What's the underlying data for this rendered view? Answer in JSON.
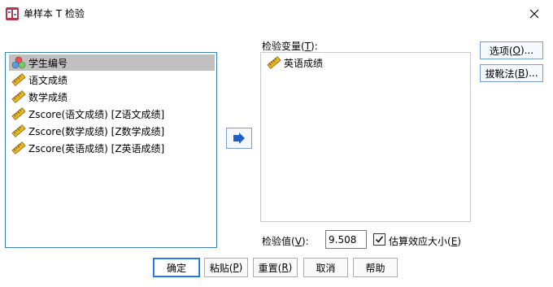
{
  "window": {
    "title": "单样本 T 检验",
    "close_icon": "close-icon"
  },
  "source_vars": [
    {
      "label": "学生编号",
      "icon": "nominal-variable-icon",
      "selected": true
    },
    {
      "label": "语文成绩",
      "icon": "scale-variable-icon",
      "selected": false
    },
    {
      "label": "数学成绩",
      "icon": "scale-variable-icon",
      "selected": false
    },
    {
      "label": "Zscore(语文成绩) [Z语文成绩]",
      "icon": "scale-variable-icon",
      "selected": false
    },
    {
      "label": "Zscore(数学成绩) [Z数学成绩]",
      "icon": "scale-variable-icon",
      "selected": false
    },
    {
      "label": "Zscore(英语成绩) [Z英语成绩]",
      "icon": "scale-variable-icon",
      "selected": false
    }
  ],
  "test_vars": {
    "label_pre": "检验变量(",
    "label_key": "T",
    "label_post": "):",
    "items": [
      {
        "label": "英语成绩",
        "icon": "scale-variable-icon"
      }
    ]
  },
  "side_buttons": {
    "options_pre": "选项(",
    "options_key": "O",
    "options_post": ")...",
    "bootstrap_pre": "拔靴法(",
    "bootstrap_key": "B",
    "bootstrap_post": ")..."
  },
  "test_value": {
    "label_pre": "检验值(",
    "label_key": "V",
    "label_post": "):",
    "value": "9.508"
  },
  "effect_size": {
    "checked": true,
    "label_pre": "估算效应大小(",
    "label_key": "E",
    "label_post": ")"
  },
  "bottom_buttons": {
    "ok": "确定",
    "paste_pre": "粘贴(",
    "paste_key": "P",
    "paste_post": ")",
    "reset_pre": "重置(",
    "reset_key": "R",
    "reset_post": ")",
    "cancel": "取消",
    "help": "帮助"
  },
  "colors": {
    "accent_border": "#3c7fb1",
    "selected_bg": "#c0c0c0",
    "ruler_yellow": "#e8b320"
  }
}
